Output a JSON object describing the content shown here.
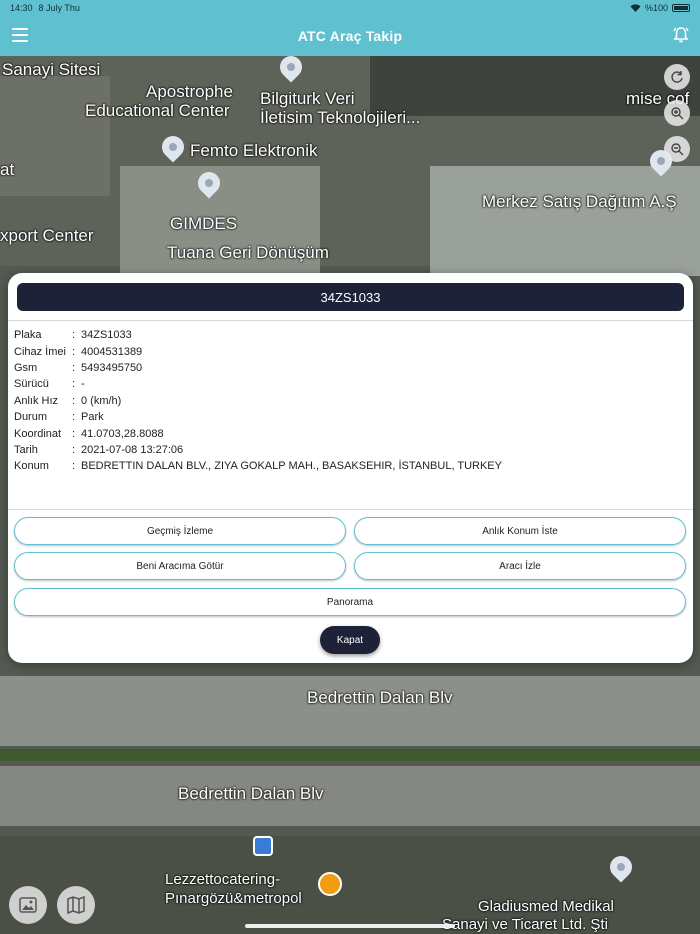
{
  "status": {
    "time": "14:30",
    "date": "8 July Thu",
    "battery": "%100"
  },
  "appbar": {
    "title": "ATC Araç Takip"
  },
  "map_labels": {
    "sanayi": "Sanayi Sitesi",
    "apostrophe1": "Apostrophe",
    "apostrophe2": "Educational Center",
    "bilgiturk1": "Bilgiturk Veri",
    "bilgiturk2": "İletisim Teknolojileri...",
    "mise": "mise cof",
    "femto": "Femto Elektronik",
    "gimdes": "GIMDES",
    "tuana": "Tuana Geri Dönüşüm",
    "merkez": "Merkez Satış Dağıtım A.Ş",
    "export": "xport Center",
    "at": "at",
    "bedrettin1": "Bedrettin Dalan Blv",
    "bedrettin2": "Bedrettin Dalan Blv",
    "lezzet1": "Lezzettocatering-",
    "lezzet2": "Pınargözü&metropol",
    "gladius1": "Gladiusmed Medikal",
    "gladius2": "Sanayi ve Ticaret Ltd. Şti"
  },
  "vehicle": {
    "plate_title": "34ZS1033",
    "rows": [
      {
        "key": "Plaka",
        "value": "34ZS1033"
      },
      {
        "key": "Cihaz İmei",
        "value": "4004531389"
      },
      {
        "key": "Gsm",
        "value": "5493495750"
      },
      {
        "key": "Sürücü",
        "value": "-"
      },
      {
        "key": "Anlık Hız",
        "value": "0 (km/h)"
      },
      {
        "key": "Durum",
        "value": "Park"
      },
      {
        "key": "Koordinat",
        "value": "41.0703,28.8088"
      },
      {
        "key": "Tarih",
        "value": "2021-07-08 13:27:06"
      },
      {
        "key": "Konum",
        "value": "BEDRETTIN DALAN BLV., ZIYA GOKALP MAH., BASAKSEHIR, İSTANBUL, TURKEY"
      }
    ],
    "separator": ":"
  },
  "actions": {
    "history": "Geçmiş İzleme",
    "request_location": "Anlık Konum İste",
    "take_me": "Beni Aracıma Götür",
    "follow": "Aracı İzle",
    "panorama": "Panorama",
    "close": "Kapat"
  },
  "colors": {
    "accent": "#5fc0cf",
    "dark": "#1d2238"
  }
}
